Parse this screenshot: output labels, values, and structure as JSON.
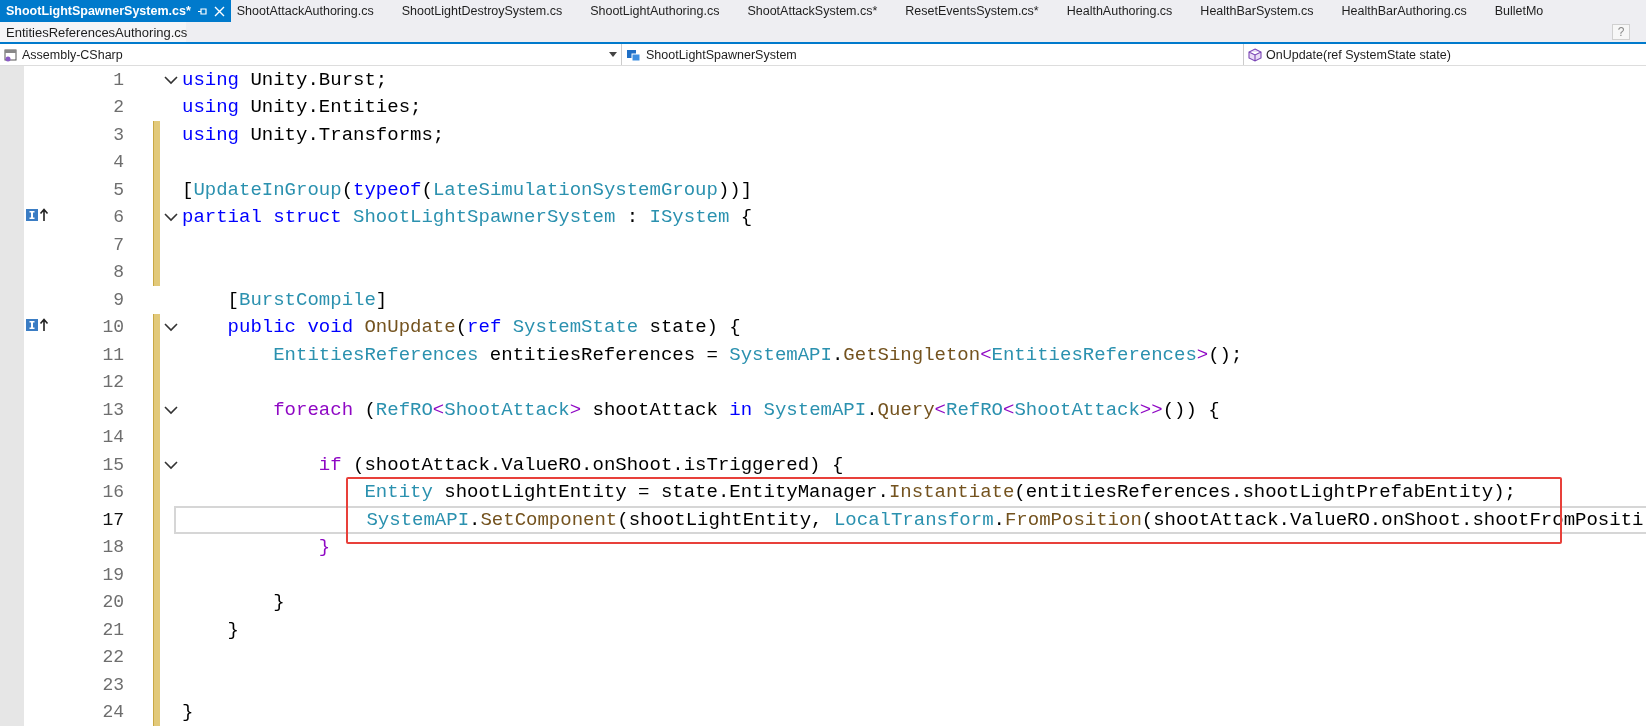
{
  "tabs": [
    {
      "label": "ShootLightSpawnerSystem.cs*",
      "selected": true
    },
    {
      "label": "ShootAttackAuthoring.cs",
      "selected": false
    },
    {
      "label": "ShootLightDestroySystem.cs",
      "selected": false
    },
    {
      "label": "ShootLightAuthoring.cs",
      "selected": false
    },
    {
      "label": "ShootAttackSystem.cs*",
      "selected": false
    },
    {
      "label": "ResetEventsSystem.cs*",
      "selected": false
    },
    {
      "label": "HealthAuthoring.cs",
      "selected": false
    },
    {
      "label": "HealthBarSystem.cs",
      "selected": false
    },
    {
      "label": "HealthBarAuthoring.cs",
      "selected": false
    },
    {
      "label": "BulletMo",
      "selected": false
    }
  ],
  "preview_tab": {
    "label": "EntitiesReferencesAuthoring.cs"
  },
  "help_button": "?",
  "navigation_bar": {
    "project": "Assembly-CSharp",
    "type": "ShootLightSpawnerSystem",
    "member": "OnUpdate(ref SystemState state)"
  },
  "editor": {
    "lines": [
      {
        "number": "1",
        "foldable": true,
        "modified": false,
        "marker": false,
        "current": false,
        "annotated": false,
        "tokens": [
          {
            "text": "using",
            "kind": "keyword"
          },
          {
            "text": " Unity.Burst;",
            "kind": "plain"
          }
        ]
      },
      {
        "number": "2",
        "foldable": false,
        "modified": false,
        "marker": false,
        "current": false,
        "annotated": false,
        "tokens": [
          {
            "text": "using",
            "kind": "keyword"
          },
          {
            "text": " Unity.Entities;",
            "kind": "plain"
          }
        ]
      },
      {
        "number": "3",
        "foldable": false,
        "modified": true,
        "marker": false,
        "current": false,
        "annotated": false,
        "tokens": [
          {
            "text": "using",
            "kind": "keyword"
          },
          {
            "text": " Unity.Transforms;",
            "kind": "plain"
          }
        ]
      },
      {
        "number": "4",
        "foldable": false,
        "modified": true,
        "marker": false,
        "current": false,
        "annotated": false
      },
      {
        "number": "5",
        "foldable": false,
        "modified": true,
        "marker": false,
        "current": false,
        "annotated": false,
        "tokens": [
          {
            "text": "[",
            "kind": "plain"
          },
          {
            "text": "UpdateInGroup",
            "kind": "type"
          },
          {
            "text": "(",
            "kind": "plain"
          },
          {
            "text": "typeof",
            "kind": "keyword"
          },
          {
            "text": "(",
            "kind": "plain"
          },
          {
            "text": "LateSimulationSystemGroup",
            "kind": "type"
          },
          {
            "text": "))]",
            "kind": "plain"
          }
        ]
      },
      {
        "number": "6",
        "foldable": true,
        "modified": true,
        "marker": true,
        "current": false,
        "annotated": false,
        "tokens": [
          {
            "text": "partial",
            "kind": "keyword"
          },
          {
            "text": " struct",
            "kind": "keyword"
          },
          {
            "text": " ShootLightSpawnerSystem",
            "kind": "type"
          },
          {
            "text": " : ",
            "kind": "plain"
          },
          {
            "text": "ISystem",
            "kind": "type"
          },
          {
            "text": " {",
            "kind": "plain"
          }
        ]
      },
      {
        "number": "7",
        "foldable": false,
        "modified": true,
        "marker": false,
        "current": false,
        "annotated": false
      },
      {
        "number": "8",
        "foldable": false,
        "modified": true,
        "marker": false,
        "current": false,
        "annotated": false
      },
      {
        "number": "9",
        "foldable": false,
        "modified": false,
        "marker": false,
        "current": false,
        "annotated": false,
        "tokens": [
          {
            "text": "    [",
            "kind": "plain"
          },
          {
            "text": "BurstCompile",
            "kind": "type"
          },
          {
            "text": "]",
            "kind": "plain"
          }
        ]
      },
      {
        "number": "10",
        "foldable": true,
        "modified": true,
        "marker": true,
        "current": false,
        "annotated": false,
        "tokens": [
          {
            "text": "    public",
            "kind": "keyword"
          },
          {
            "text": " void",
            "kind": "keyword"
          },
          {
            "text": " OnUpdate",
            "kind": "method"
          },
          {
            "text": "(",
            "kind": "plain"
          },
          {
            "text": "ref",
            "kind": "keyword"
          },
          {
            "text": " SystemState",
            "kind": "type"
          },
          {
            "text": " state) {",
            "kind": "plain"
          }
        ]
      },
      {
        "number": "11",
        "foldable": false,
        "modified": true,
        "marker": false,
        "current": false,
        "annotated": false,
        "tokens": [
          {
            "text": "        EntitiesReferences",
            "kind": "type"
          },
          {
            "text": " entitiesReferences = ",
            "kind": "plain"
          },
          {
            "text": "SystemAPI",
            "kind": "type"
          },
          {
            "text": ".",
            "kind": "plain"
          },
          {
            "text": "GetSingleton",
            "kind": "method"
          },
          {
            "text": "<",
            "kind": "generic"
          },
          {
            "text": "EntitiesReferences",
            "kind": "type"
          },
          {
            "text": ">",
            "kind": "generic"
          },
          {
            "text": "();",
            "kind": "plain"
          }
        ]
      },
      {
        "number": "12",
        "foldable": false,
        "modified": true,
        "marker": false,
        "current": false,
        "annotated": false
      },
      {
        "number": "13",
        "foldable": true,
        "modified": true,
        "marker": false,
        "current": false,
        "annotated": false,
        "tokens": [
          {
            "text": "        foreach",
            "kind": "control"
          },
          {
            "text": " (",
            "kind": "plain"
          },
          {
            "text": "RefRO",
            "kind": "type"
          },
          {
            "text": "<",
            "kind": "generic"
          },
          {
            "text": "ShootAttack",
            "kind": "type"
          },
          {
            "text": ">",
            "kind": "generic"
          },
          {
            "text": " shootAttack ",
            "kind": "plain"
          },
          {
            "text": "in",
            "kind": "keyword"
          },
          {
            "text": " SystemAPI",
            "kind": "type"
          },
          {
            "text": ".",
            "kind": "plain"
          },
          {
            "text": "Query",
            "kind": "method"
          },
          {
            "text": "<",
            "kind": "generic"
          },
          {
            "text": "RefRO",
            "kind": "type"
          },
          {
            "text": "<",
            "kind": "generic"
          },
          {
            "text": "ShootAttack",
            "kind": "type"
          },
          {
            "text": ">>",
            "kind": "generic"
          },
          {
            "text": "()) {",
            "kind": "plain"
          }
        ]
      },
      {
        "number": "14",
        "foldable": false,
        "modified": true,
        "marker": false,
        "current": false,
        "annotated": false
      },
      {
        "number": "15",
        "foldable": true,
        "modified": true,
        "marker": false,
        "current": false,
        "annotated": false,
        "tokens": [
          {
            "text": "            if",
            "kind": "control"
          },
          {
            "text": " (shootAttack.ValueRO.onShoot.isTriggered) {",
            "kind": "plain"
          }
        ]
      },
      {
        "number": "16",
        "foldable": false,
        "modified": true,
        "marker": false,
        "current": false,
        "annotated": true,
        "tokens": [
          {
            "text": "                Entity",
            "kind": "type"
          },
          {
            "text": " shootLightEntity = state.EntityManager.",
            "kind": "plain"
          },
          {
            "text": "Instantiate",
            "kind": "method"
          },
          {
            "text": "(entitiesReferences.shootLightPrefabEntity);",
            "kind": "plain"
          }
        ]
      },
      {
        "number": "17",
        "foldable": false,
        "modified": true,
        "marker": false,
        "current": true,
        "annotated": true,
        "tokens": [
          {
            "text": "                SystemAPI",
            "kind": "type"
          },
          {
            "text": ".",
            "kind": "plain"
          },
          {
            "text": "SetComponent",
            "kind": "method"
          },
          {
            "text": "(shootLightEntity, ",
            "kind": "plain"
          },
          {
            "text": "LocalTransform",
            "kind": "type"
          },
          {
            "text": ".",
            "kind": "plain"
          },
          {
            "text": "FromPosition",
            "kind": "method"
          },
          {
            "text": "(shootAttack.ValueRO.onShoot.shootFromPositi",
            "kind": "plain"
          }
        ]
      },
      {
        "number": "18",
        "foldable": false,
        "modified": true,
        "marker": false,
        "current": false,
        "annotated": false,
        "tokens": [
          {
            "text": "            }",
            "kind": "control"
          }
        ]
      },
      {
        "number": "19",
        "foldable": false,
        "modified": true,
        "marker": false,
        "current": false,
        "annotated": false
      },
      {
        "number": "20",
        "foldable": false,
        "modified": true,
        "marker": false,
        "current": false,
        "annotated": false,
        "tokens": [
          {
            "text": "        }",
            "kind": "plain"
          }
        ]
      },
      {
        "number": "21",
        "foldable": false,
        "modified": true,
        "marker": false,
        "current": false,
        "annotated": false,
        "tokens": [
          {
            "text": "    }",
            "kind": "plain"
          }
        ]
      },
      {
        "number": "22",
        "foldable": false,
        "modified": true,
        "marker": false,
        "current": false,
        "annotated": false
      },
      {
        "number": "23",
        "foldable": false,
        "modified": true,
        "marker": false,
        "current": false,
        "annotated": false
      },
      {
        "number": "24",
        "foldable": false,
        "modified": true,
        "marker": false,
        "current": false,
        "annotated": false,
        "tokens": [
          {
            "text": "}",
            "kind": "plain"
          }
        ]
      }
    ]
  }
}
